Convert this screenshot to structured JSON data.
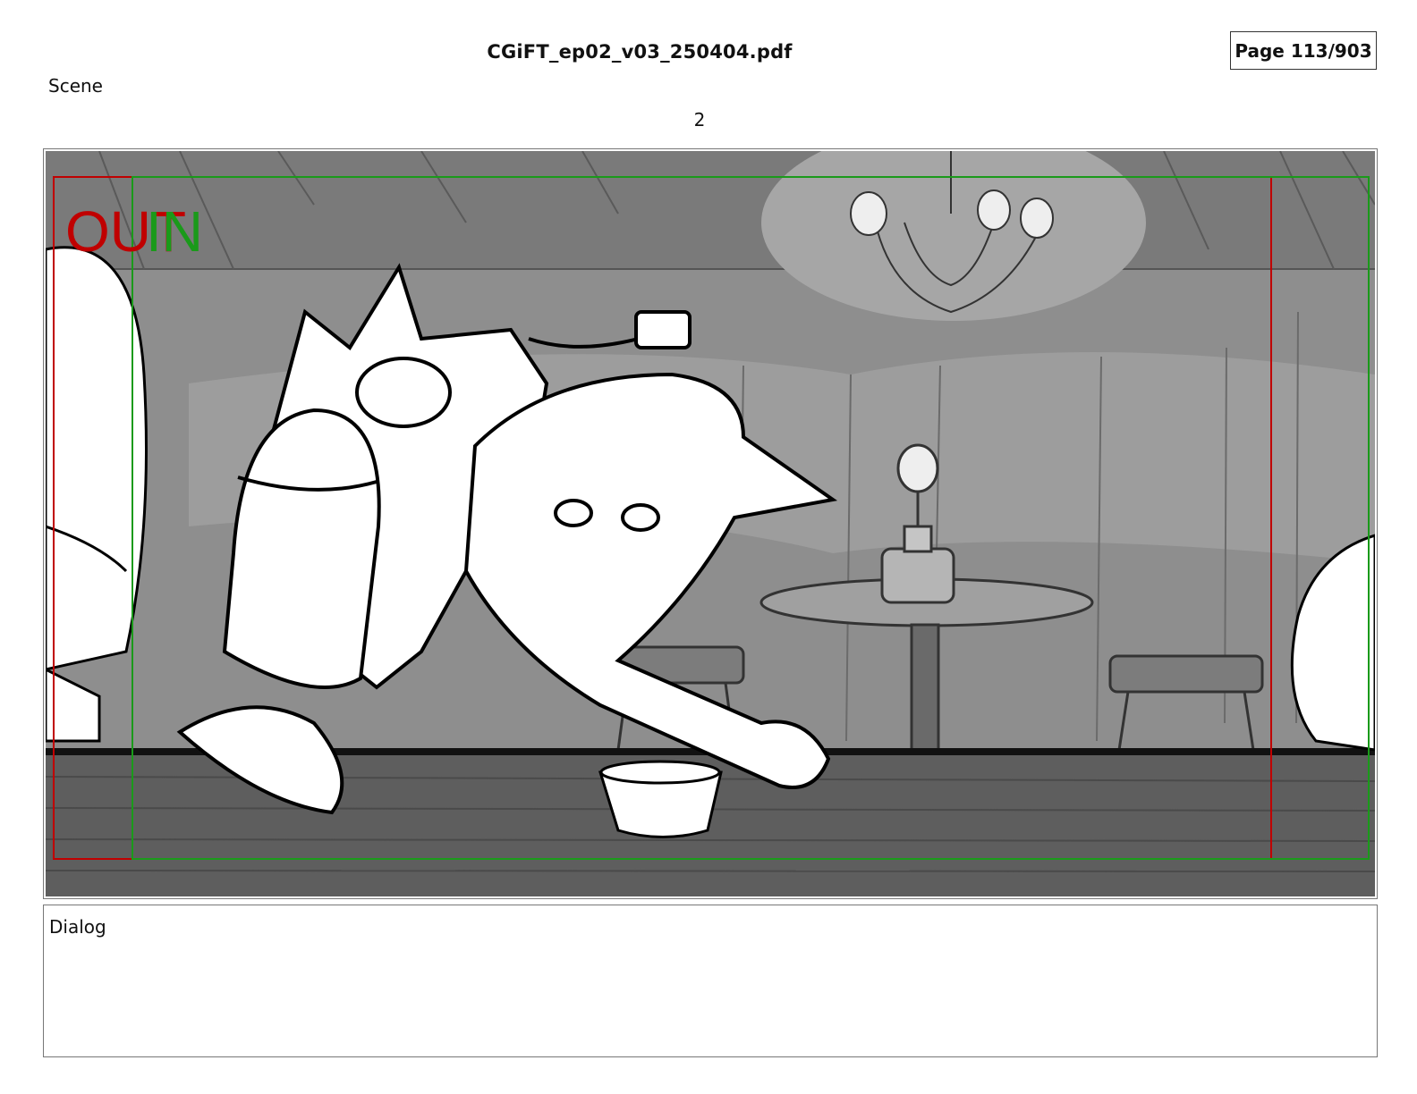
{
  "header": {
    "file_title": "CGiFT_ep02_v03_250404.pdf",
    "page_label": "Page 113/903"
  },
  "scene": {
    "label": "Scene",
    "number": "2"
  },
  "panel": {
    "overlay_out": "OUT",
    "overlay_in": "IN",
    "out_color": "#c00000",
    "in_color": "#1a9a1a"
  },
  "dialog": {
    "label": "Dialog",
    "text": ""
  }
}
